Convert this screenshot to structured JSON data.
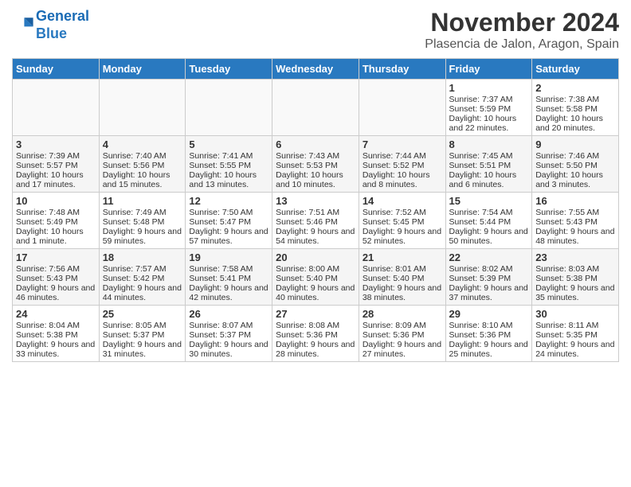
{
  "header": {
    "logo_line1": "General",
    "logo_line2": "Blue",
    "month_title": "November 2024",
    "location": "Plasencia de Jalon, Aragon, Spain"
  },
  "days_of_week": [
    "Sunday",
    "Monday",
    "Tuesday",
    "Wednesday",
    "Thursday",
    "Friday",
    "Saturday"
  ],
  "weeks": [
    {
      "row_class": "odd-row",
      "days": [
        {
          "num": "",
          "info": ""
        },
        {
          "num": "",
          "info": ""
        },
        {
          "num": "",
          "info": ""
        },
        {
          "num": "",
          "info": ""
        },
        {
          "num": "",
          "info": ""
        },
        {
          "num": "1",
          "info": "Sunrise: 7:37 AM\nSunset: 5:59 PM\nDaylight: 10 hours and 22 minutes."
        },
        {
          "num": "2",
          "info": "Sunrise: 7:38 AM\nSunset: 5:58 PM\nDaylight: 10 hours and 20 minutes."
        }
      ]
    },
    {
      "row_class": "even-row",
      "days": [
        {
          "num": "3",
          "info": "Sunrise: 7:39 AM\nSunset: 5:57 PM\nDaylight: 10 hours and 17 minutes."
        },
        {
          "num": "4",
          "info": "Sunrise: 7:40 AM\nSunset: 5:56 PM\nDaylight: 10 hours and 15 minutes."
        },
        {
          "num": "5",
          "info": "Sunrise: 7:41 AM\nSunset: 5:55 PM\nDaylight: 10 hours and 13 minutes."
        },
        {
          "num": "6",
          "info": "Sunrise: 7:43 AM\nSunset: 5:53 PM\nDaylight: 10 hours and 10 minutes."
        },
        {
          "num": "7",
          "info": "Sunrise: 7:44 AM\nSunset: 5:52 PM\nDaylight: 10 hours and 8 minutes."
        },
        {
          "num": "8",
          "info": "Sunrise: 7:45 AM\nSunset: 5:51 PM\nDaylight: 10 hours and 6 minutes."
        },
        {
          "num": "9",
          "info": "Sunrise: 7:46 AM\nSunset: 5:50 PM\nDaylight: 10 hours and 3 minutes."
        }
      ]
    },
    {
      "row_class": "odd-row",
      "days": [
        {
          "num": "10",
          "info": "Sunrise: 7:48 AM\nSunset: 5:49 PM\nDaylight: 10 hours and 1 minute."
        },
        {
          "num": "11",
          "info": "Sunrise: 7:49 AM\nSunset: 5:48 PM\nDaylight: 9 hours and 59 minutes."
        },
        {
          "num": "12",
          "info": "Sunrise: 7:50 AM\nSunset: 5:47 PM\nDaylight: 9 hours and 57 minutes."
        },
        {
          "num": "13",
          "info": "Sunrise: 7:51 AM\nSunset: 5:46 PM\nDaylight: 9 hours and 54 minutes."
        },
        {
          "num": "14",
          "info": "Sunrise: 7:52 AM\nSunset: 5:45 PM\nDaylight: 9 hours and 52 minutes."
        },
        {
          "num": "15",
          "info": "Sunrise: 7:54 AM\nSunset: 5:44 PM\nDaylight: 9 hours and 50 minutes."
        },
        {
          "num": "16",
          "info": "Sunrise: 7:55 AM\nSunset: 5:43 PM\nDaylight: 9 hours and 48 minutes."
        }
      ]
    },
    {
      "row_class": "even-row",
      "days": [
        {
          "num": "17",
          "info": "Sunrise: 7:56 AM\nSunset: 5:43 PM\nDaylight: 9 hours and 46 minutes."
        },
        {
          "num": "18",
          "info": "Sunrise: 7:57 AM\nSunset: 5:42 PM\nDaylight: 9 hours and 44 minutes."
        },
        {
          "num": "19",
          "info": "Sunrise: 7:58 AM\nSunset: 5:41 PM\nDaylight: 9 hours and 42 minutes."
        },
        {
          "num": "20",
          "info": "Sunrise: 8:00 AM\nSunset: 5:40 PM\nDaylight: 9 hours and 40 minutes."
        },
        {
          "num": "21",
          "info": "Sunrise: 8:01 AM\nSunset: 5:40 PM\nDaylight: 9 hours and 38 minutes."
        },
        {
          "num": "22",
          "info": "Sunrise: 8:02 AM\nSunset: 5:39 PM\nDaylight: 9 hours and 37 minutes."
        },
        {
          "num": "23",
          "info": "Sunrise: 8:03 AM\nSunset: 5:38 PM\nDaylight: 9 hours and 35 minutes."
        }
      ]
    },
    {
      "row_class": "odd-row",
      "days": [
        {
          "num": "24",
          "info": "Sunrise: 8:04 AM\nSunset: 5:38 PM\nDaylight: 9 hours and 33 minutes."
        },
        {
          "num": "25",
          "info": "Sunrise: 8:05 AM\nSunset: 5:37 PM\nDaylight: 9 hours and 31 minutes."
        },
        {
          "num": "26",
          "info": "Sunrise: 8:07 AM\nSunset: 5:37 PM\nDaylight: 9 hours and 30 minutes."
        },
        {
          "num": "27",
          "info": "Sunrise: 8:08 AM\nSunset: 5:36 PM\nDaylight: 9 hours and 28 minutes."
        },
        {
          "num": "28",
          "info": "Sunrise: 8:09 AM\nSunset: 5:36 PM\nDaylight: 9 hours and 27 minutes."
        },
        {
          "num": "29",
          "info": "Sunrise: 8:10 AM\nSunset: 5:36 PM\nDaylight: 9 hours and 25 minutes."
        },
        {
          "num": "30",
          "info": "Sunrise: 8:11 AM\nSunset: 5:35 PM\nDaylight: 9 hours and 24 minutes."
        }
      ]
    }
  ]
}
